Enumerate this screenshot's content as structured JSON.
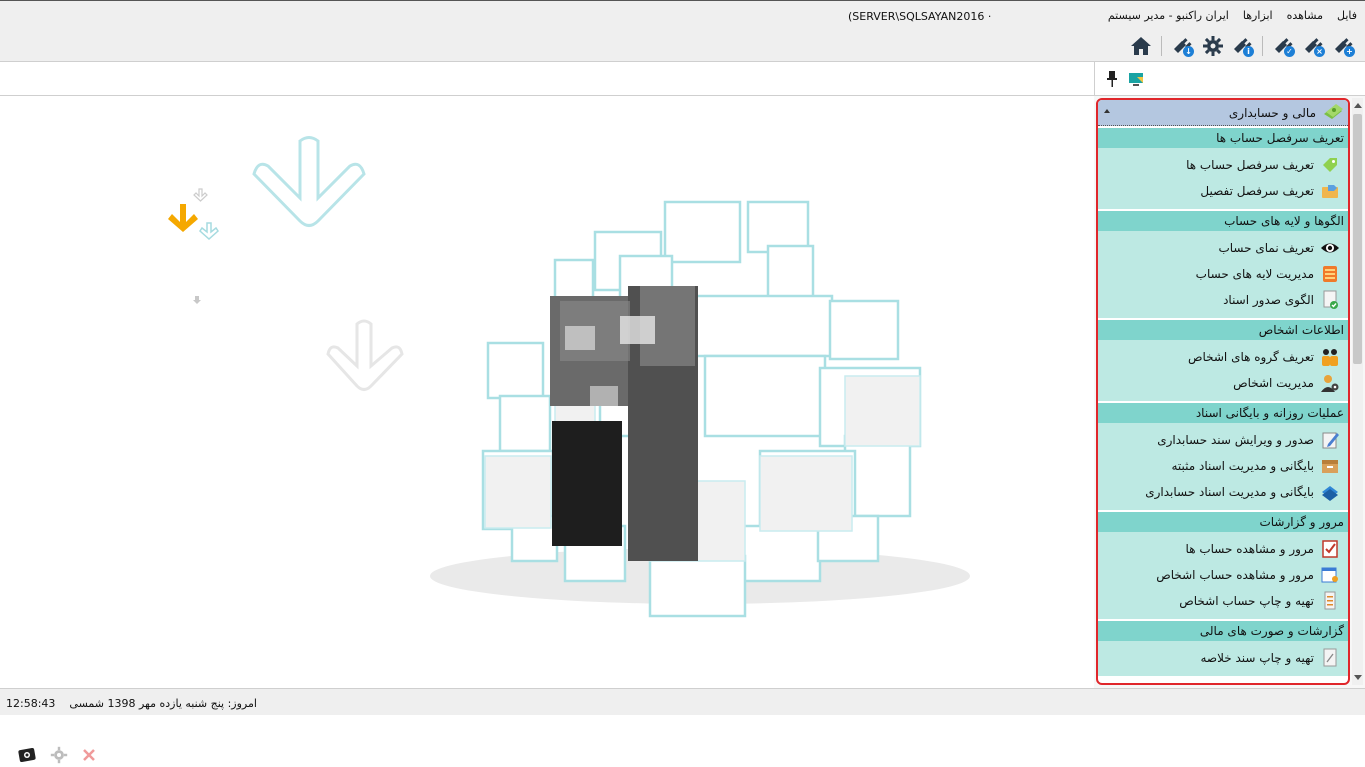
{
  "title_bar": {
    "server": "(SERVER\\SQLSAYAN2016 ·"
  },
  "menu": {
    "items": [
      {
        "label": "فایل"
      },
      {
        "label": "مشاهده"
      },
      {
        "label": "ابزارها"
      },
      {
        "label": "ایران راکنبو - مدیر سیستم"
      }
    ]
  },
  "toolbar": {
    "icons": [
      "plug-add-icon",
      "plug-remove-icon",
      "plug-check-icon",
      "plug-info-icon",
      "settings-gear-icon",
      "plug-download-icon",
      "home-icon"
    ]
  },
  "sidebar": {
    "module_title": "مالی و حسابداری",
    "groups": [
      {
        "title": "تعریف سرفصل حساب ها",
        "items": [
          {
            "label": "تعریف سرفصل حساب ها",
            "icon": "green-tag-icon"
          },
          {
            "label": "تعریف سرفصل تفصیل",
            "icon": "folder-tag-icon"
          }
        ]
      },
      {
        "title": "الگوها و لایه های حساب",
        "items": [
          {
            "label": "تعریف نمای حساب",
            "icon": "eye-icon"
          },
          {
            "label": "مدیریت لایه های حساب",
            "icon": "layers-icon"
          },
          {
            "label": "الگوی صدور اسناد",
            "icon": "document-check-icon"
          }
        ]
      },
      {
        "title": "اطلاعات اشخاص",
        "items": [
          {
            "label": "تعریف گروه های اشخاص",
            "icon": "people-group-icon"
          },
          {
            "label": "مدیریت اشخاص",
            "icon": "person-settings-icon"
          }
        ]
      },
      {
        "title": "عملیات روزانه و بایگانی اسناد",
        "items": [
          {
            "label": "صدور و ویرایش سند حسابداری",
            "icon": "edit-document-icon"
          },
          {
            "label": "بایگانی و مدیریت اسناد مثبته",
            "icon": "archive-box-icon"
          },
          {
            "label": "بایگانی و مدیریت اسناد حسابداری",
            "icon": "book-stack-icon"
          }
        ]
      },
      {
        "title": "مرور و گزارشات",
        "items": [
          {
            "label": "مرور و مشاهده حساب ها",
            "icon": "checklist-icon"
          },
          {
            "label": "مرور و مشاهده حساب اشخاص",
            "icon": "calendar-person-icon"
          },
          {
            "label": "تهیه و چاپ حساب اشخاص",
            "icon": "printer-document-icon"
          }
        ]
      },
      {
        "title": "گزارشات و صورت های مالی",
        "items": [
          {
            "label": "تهیه و چاپ سند خلاصه",
            "icon": "summary-document-icon"
          }
        ]
      }
    ]
  },
  "status_bar": {
    "date_text": "امروز: پنج شنبه یازده مهر 1398  شمسی",
    "time": "12:58:43"
  },
  "colors": {
    "panel_border": "#e0262b",
    "group_title_bg": "#7fd4cc",
    "group_body_bg": "#bde9e3",
    "header_bg": "#b4c7e0"
  }
}
